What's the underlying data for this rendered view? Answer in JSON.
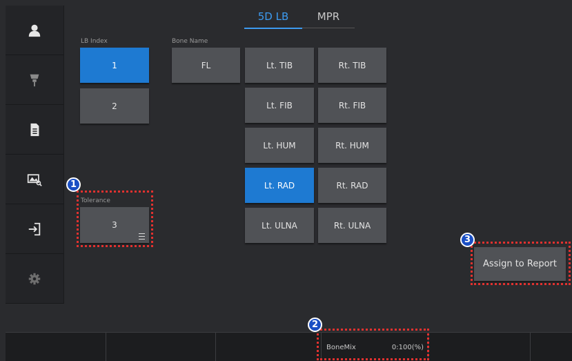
{
  "tabs": [
    {
      "label": "5D LB",
      "active": true
    },
    {
      "label": "MPR",
      "active": false
    }
  ],
  "lb_index": {
    "label": "LB Index",
    "items": [
      {
        "label": "1",
        "selected": true
      },
      {
        "label": "2",
        "selected": false
      }
    ]
  },
  "bone_name": {
    "label": "Bone Name",
    "fl": "FL",
    "items": [
      {
        "label": "Lt. TIB",
        "selected": false
      },
      {
        "label": "Rt. TIB",
        "selected": false
      },
      {
        "label": "Lt. FIB",
        "selected": false
      },
      {
        "label": "Rt. FIB",
        "selected": false
      },
      {
        "label": "Lt. HUM",
        "selected": false
      },
      {
        "label": "Rt. HUM",
        "selected": false
      },
      {
        "label": "Lt. RAD",
        "selected": true
      },
      {
        "label": "Rt. RAD",
        "selected": false
      },
      {
        "label": "Lt. ULNA",
        "selected": false
      },
      {
        "label": "Rt. ULNA",
        "selected": false
      }
    ]
  },
  "tolerance": {
    "label": "Tolerance",
    "value": "3"
  },
  "assign_button": "Assign to Report",
  "bottom_bar": {
    "bonemix_label": "BoneMix",
    "bonemix_value": "0:100(%)"
  },
  "callouts": [
    "1",
    "2",
    "3"
  ],
  "sidebar_icons": [
    "patient-icon",
    "probe-icon",
    "report-icon",
    "image-review-icon",
    "exit-icon",
    "settings-icon"
  ],
  "colors": {
    "accent": "#1e7ad2",
    "tab_active": "#3d9bf0",
    "callout_border": "#e3312f",
    "callout_badge": "#1a4fc4"
  }
}
